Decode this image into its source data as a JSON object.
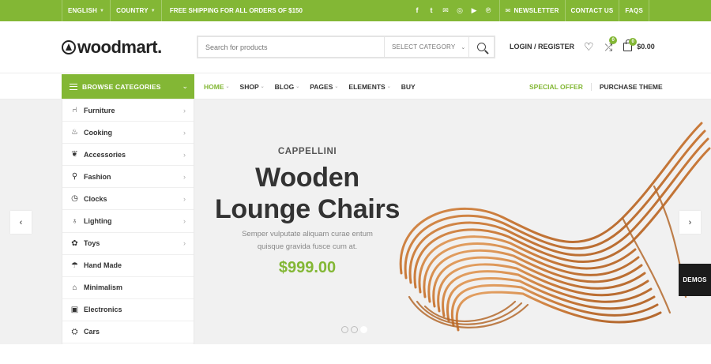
{
  "topbar": {
    "language": "ENGLISH",
    "country": "COUNTRY",
    "shipping": "FREE SHIPPING FOR ALL ORDERS OF $150",
    "social_icons": [
      "facebook-icon",
      "twitter-icon",
      "email-icon",
      "instagram-icon",
      "youtube-icon",
      "pinterest-icon"
    ],
    "newsletter": "NEWSLETTER",
    "contact": "CONTACT US",
    "faqs": "FAQS"
  },
  "header": {
    "logo": "woodmart.",
    "search_placeholder": "Search for products",
    "category_select": "SELECT CATEGORY",
    "login": "LOGIN / REGISTER",
    "compare_count": "0",
    "cart_count": "0",
    "cart_total": "$0.00"
  },
  "nav": {
    "browse": "BROWSE CATEGORIES",
    "items": [
      {
        "label": "HOME",
        "active": true,
        "has_caret": true
      },
      {
        "label": "SHOP",
        "active": false,
        "has_caret": true
      },
      {
        "label": "BLOG",
        "active": false,
        "has_caret": true
      },
      {
        "label": "PAGES",
        "active": false,
        "has_caret": true
      },
      {
        "label": "ELEMENTS",
        "active": false,
        "has_caret": true
      },
      {
        "label": "BUY",
        "active": false,
        "has_caret": false
      }
    ],
    "special_offer": "SPECIAL OFFER",
    "purchase": "PURCHASE THEME"
  },
  "categories": [
    {
      "label": "Furniture",
      "icon": "chair-icon",
      "arrow": true
    },
    {
      "label": "Cooking",
      "icon": "cooking-icon",
      "arrow": true
    },
    {
      "label": "Accessories",
      "icon": "accessories-icon",
      "arrow": true
    },
    {
      "label": "Fashion",
      "icon": "shirt-icon",
      "arrow": true
    },
    {
      "label": "Clocks",
      "icon": "clock-icon",
      "arrow": true
    },
    {
      "label": "Lighting",
      "icon": "bulb-icon",
      "arrow": true
    },
    {
      "label": "Toys",
      "icon": "toy-icon",
      "arrow": true
    },
    {
      "label": "Hand Made",
      "icon": "handmade-icon",
      "arrow": false
    },
    {
      "label": "Minimalism",
      "icon": "minimalism-icon",
      "arrow": false
    },
    {
      "label": "Electronics",
      "icon": "electronics-icon",
      "arrow": false
    },
    {
      "label": "Cars",
      "icon": "car-icon",
      "arrow": false
    }
  ],
  "slide": {
    "subtitle": "CAPPELLINI",
    "title_line1": "Wooden",
    "title_line2": "Lounge Chairs",
    "desc_line1": "Semper vulputate aliquam curae entum",
    "desc_line2": "quisque gravida fusce cum at.",
    "price": "$999.00",
    "dots": 3,
    "active_dot": 2
  },
  "demos": "DEMOS",
  "colors": {
    "accent": "#83b735",
    "dark": "#333333"
  }
}
